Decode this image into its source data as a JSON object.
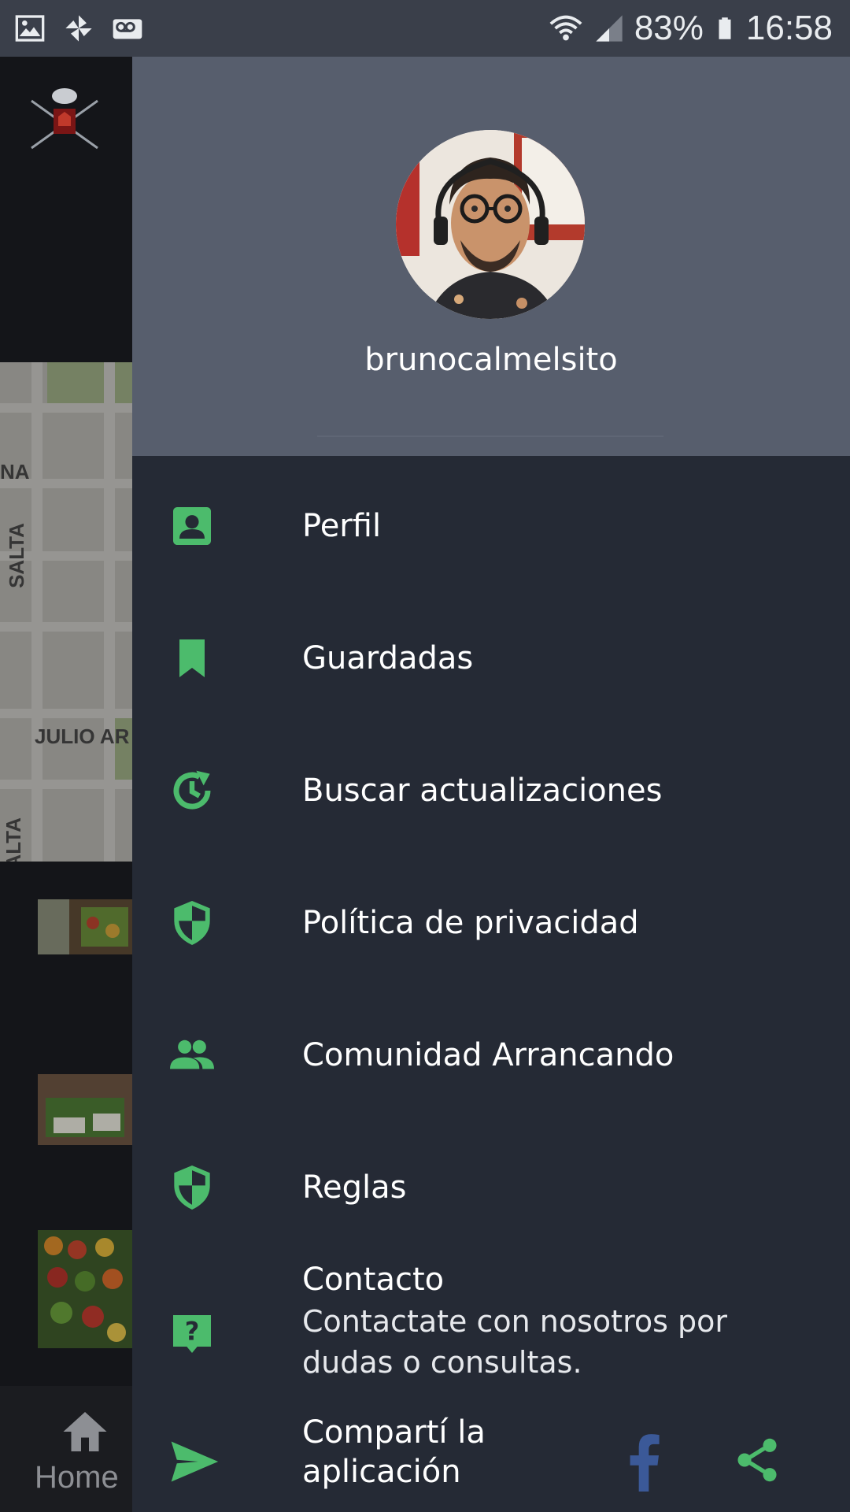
{
  "status_bar": {
    "battery": "83%",
    "time": "16:58"
  },
  "background_app": {
    "map_labels": [
      "NA",
      "SALTA",
      "JULIO AR",
      "SALTA"
    ],
    "nav_home_label": "Home"
  },
  "drawer": {
    "username": "brunocalmelsito",
    "items": [
      {
        "label": "Perfil",
        "icon": "profile-icon"
      },
      {
        "label": "Guardadas",
        "icon": "bookmark-icon"
      },
      {
        "label": "Buscar actualizaciones",
        "icon": "update-icon"
      },
      {
        "label": "Política de privacidad",
        "icon": "shield-icon"
      },
      {
        "label": "Comunidad Arrancando",
        "icon": "group-icon"
      },
      {
        "label": "Reglas",
        "icon": "shield-icon"
      }
    ],
    "contact": {
      "title": "Contacto",
      "subtitle": "Contactate con nosotros por dudas o consultas.",
      "icon": "help-icon"
    },
    "share": {
      "label": "Compartí la aplicación",
      "icon": "send-icon"
    }
  },
  "colors": {
    "accent": "#4cbb6c",
    "drawer_bg": "#252a35",
    "header_bg": "#575e6d",
    "facebook": "#3b5998"
  }
}
